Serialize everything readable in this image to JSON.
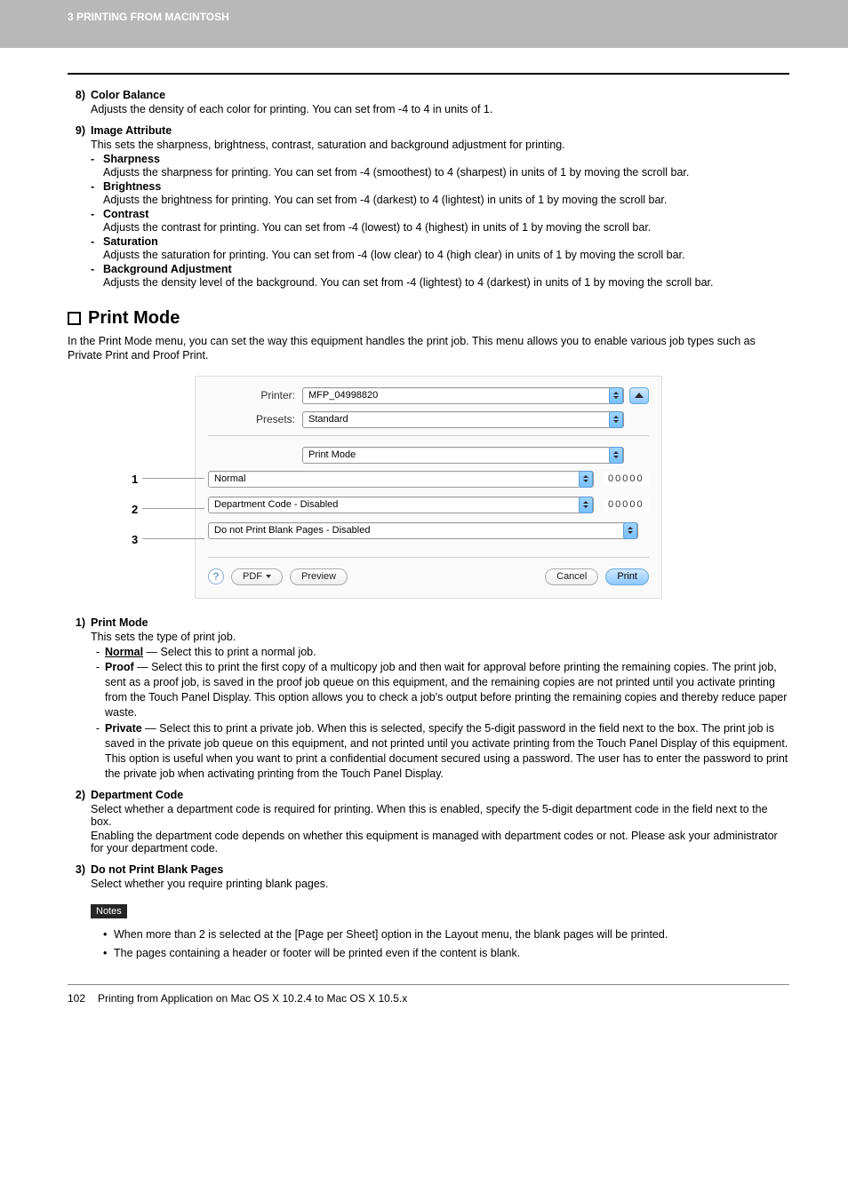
{
  "header": {
    "title": "3 PRINTING FROM MACINTOSH"
  },
  "item8": {
    "num": "8)",
    "title": "Color Balance",
    "desc": "Adjusts the density of each color for printing.  You can set from -4 to 4 in units of 1."
  },
  "item9": {
    "num": "9)",
    "title": "Image Attribute",
    "desc": "This sets the sharpness, brightness, contrast, saturation and background adjustment for printing.",
    "subs": {
      "sharpness": {
        "label": "Sharpness",
        "desc": "Adjusts the sharpness for printing. You can set from -4 (smoothest) to 4 (sharpest) in units of 1 by moving the scroll bar."
      },
      "brightness": {
        "label": "Brightness",
        "desc": "Adjusts the brightness for printing. You can set from -4 (darkest) to 4 (lightest) in units of 1 by moving the scroll bar."
      },
      "contrast": {
        "label": "Contrast",
        "desc": "Adjusts the contrast for printing. You can set from -4 (lowest) to 4 (highest) in units of 1 by moving the scroll bar."
      },
      "saturation": {
        "label": "Saturation",
        "desc": "Adjusts the saturation for printing.  You can set from -4 (low clear) to 4 (high clear) in units of 1 by moving the scroll bar."
      },
      "background": {
        "label": "Background Adjustment",
        "desc": "Adjusts the density level of the background. You can set from -4 (lightest) to 4 (darkest) in units of 1 by moving the scroll bar."
      }
    }
  },
  "section": {
    "title": "Print Mode",
    "intro": "In the Print Mode menu, you can set the way this equipment handles the print job.  This menu allows you to enable various job types such as Private Print and Proof Print."
  },
  "dialog": {
    "printer_label": "Printer:",
    "printer_value": "MFP_04998820",
    "presets_label": "Presets:",
    "presets_value": "Standard",
    "panel_value": "Print Mode",
    "opt1": "Normal",
    "opt2": "Department Code - Disabled",
    "opt3": "Do not Print Blank Pages - Disabled",
    "code1": "00000",
    "code2": "00000",
    "help": "?",
    "pdf": "PDF",
    "preview": "Preview",
    "cancel": "Cancel",
    "print": "Print",
    "callouts": {
      "n1": "1",
      "n2": "2",
      "n3": "3"
    }
  },
  "items_desc": {
    "i1": {
      "num": "1)",
      "title": "Print Mode",
      "desc": "This sets the type of print job.",
      "normal_label": "Normal",
      "normal_tail": " — Select this to print a normal job.",
      "proof_label": "Proof",
      "proof_tail": " — Select this to print the first copy of a multicopy job and then wait for approval before printing the remaining copies.  The print job, sent as a proof job, is saved in the proof job queue on this equipment, and the remaining copies are not printed until you activate printing from the Touch Panel Display.  This option allows you to check a job's output before printing the remaining copies and thereby reduce paper waste.",
      "private_label": "Private",
      "private_tail": " — Select this to print a private job.   When this is selected, specify the 5-digit password in the field next to the box.  The print job is saved in the private job queue on this equipment, and not printed until you activate printing from the Touch Panel Display of this equipment.  This option is useful when you want to print a confidential document secured using a password.  The user has to enter the password to print the private job when activating printing from the Touch Panel Display."
    },
    "i2": {
      "num": "2)",
      "title": "Department Code",
      "p1": "Select whether a department code is required for printing. When this is enabled, specify the 5-digit department code in the field next to the box.",
      "p2": "Enabling the department code depends on whether this equipment is managed with department codes or not.  Please ask your administrator for your department code."
    },
    "i3": {
      "num": "3)",
      "title": "Do not Print Blank Pages",
      "desc": "Select whether you require printing blank pages."
    }
  },
  "notes": {
    "label": "Notes",
    "n1": "When more than 2 is selected at the [Page per Sheet] option in the Layout menu, the blank pages will be printed.",
    "n2": "The pages containing a header or footer will be printed even if the content is blank."
  },
  "footer": {
    "page": "102",
    "text": "Printing from Application on Mac OS X 10.2.4 to Mac OS X 10.5.x"
  }
}
